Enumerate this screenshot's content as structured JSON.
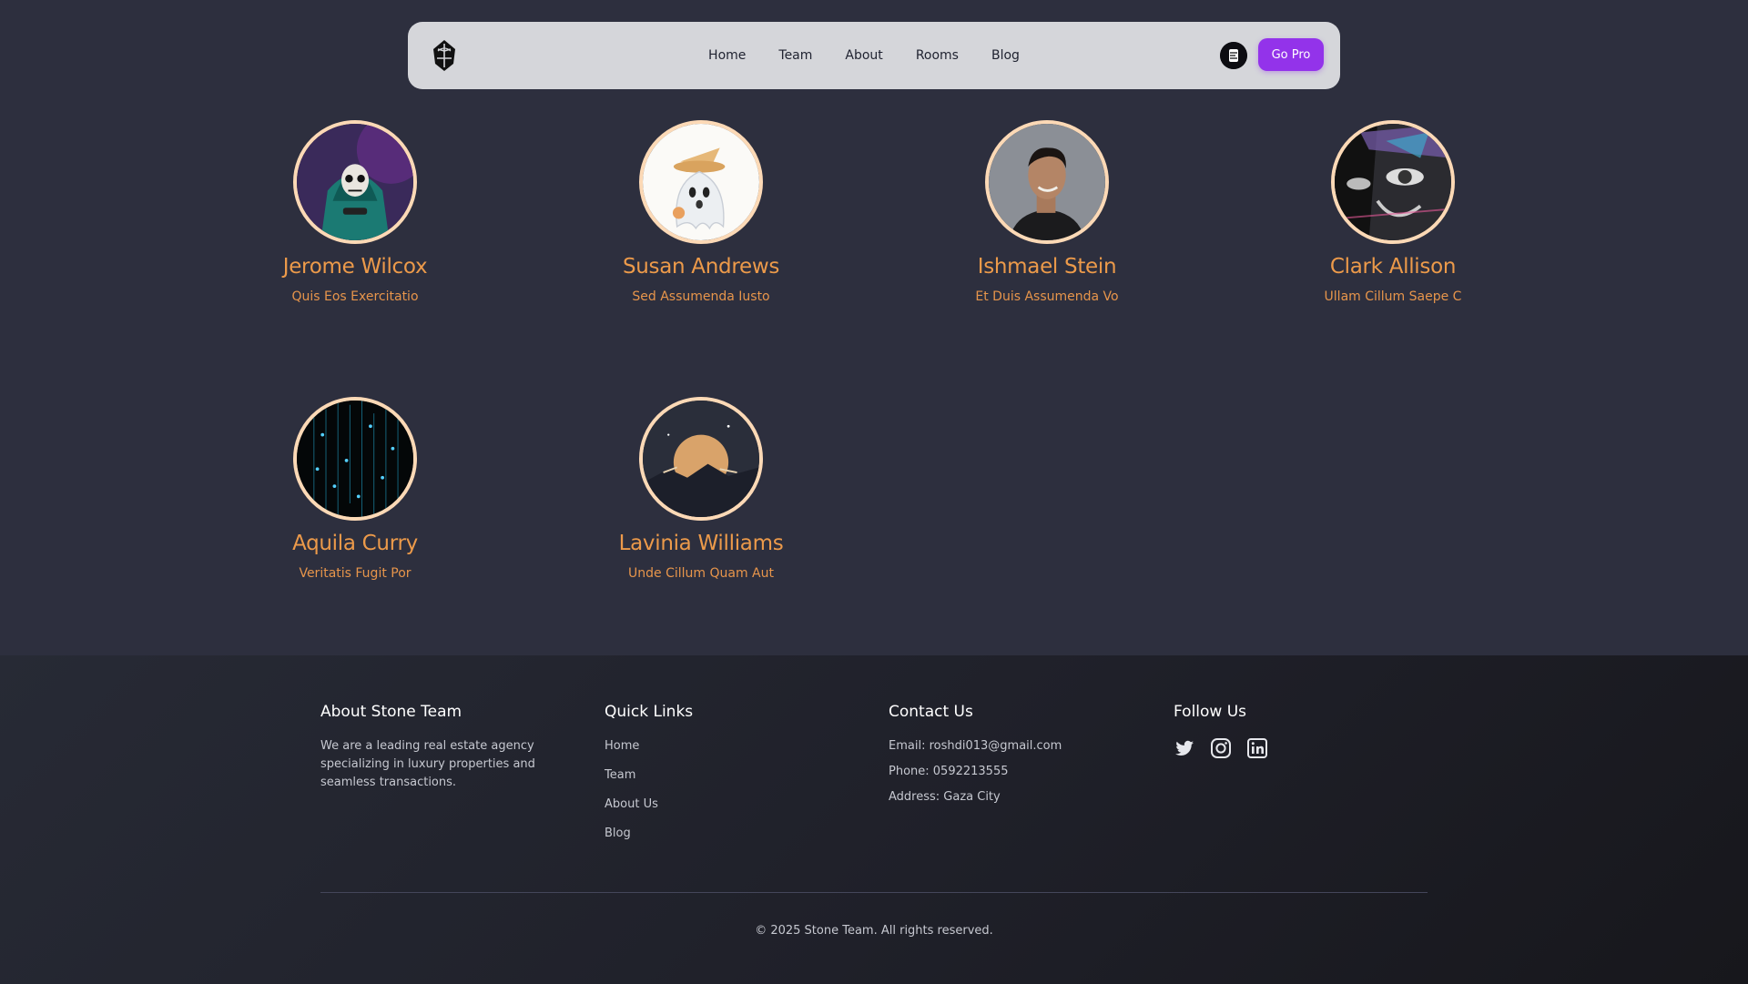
{
  "nav": {
    "links": [
      "Home",
      "Team",
      "About",
      "Rooms",
      "Blog"
    ],
    "cta_label": "Go Pro",
    "logo_icon": "stone-leaf-logo-icon",
    "avatar_icon": "user-avatar-icon"
  },
  "team": [
    {
      "name": "Jerome Wilcox",
      "role": "Quis Eos Exercitatio",
      "photo": "skeleton-hooded-avatar"
    },
    {
      "name": "Susan Andrews",
      "role": "Sed Assumenda Iusto",
      "photo": "ghost-witch-hat-avatar"
    },
    {
      "name": "Ishmael Stein",
      "role": "Et Duis Assumenda Vo",
      "photo": "man-portrait-avatar"
    },
    {
      "name": "Clark Allison",
      "role": "Ullam Cillum Saepe C",
      "photo": "graffiti-face-avatar"
    },
    {
      "name": "Aquila Curry",
      "role": "Veritatis Fugit Por",
      "photo": "digital-rain-avatar"
    },
    {
      "name": "Lavinia Williams",
      "role": "Unde Cillum Quam Aut",
      "photo": "moon-mountain-avatar"
    }
  ],
  "footer": {
    "about": {
      "title": "About Stone Team",
      "text": "We are a leading real estate agency specializing in luxury properties and seamless transactions."
    },
    "quick_links": {
      "title": "Quick Links",
      "items": [
        "Home",
        "Team",
        "About Us",
        "Blog"
      ]
    },
    "contact": {
      "title": "Contact Us",
      "email": "Email: roshdi013@gmail.com",
      "phone": "Phone: 0592213555",
      "address": "Address: Gaza City"
    },
    "follow": {
      "title": "Follow Us",
      "icons": [
        "twitter-icon",
        "instagram-icon",
        "linkedin-icon"
      ]
    },
    "copyright": "© 2025 Stone Team. All rights reserved."
  },
  "colors": {
    "background": "#2d2f3e",
    "accent": "#ec9a4a",
    "cta": "#9333ea",
    "avatar_border": "#fcd9b6"
  }
}
